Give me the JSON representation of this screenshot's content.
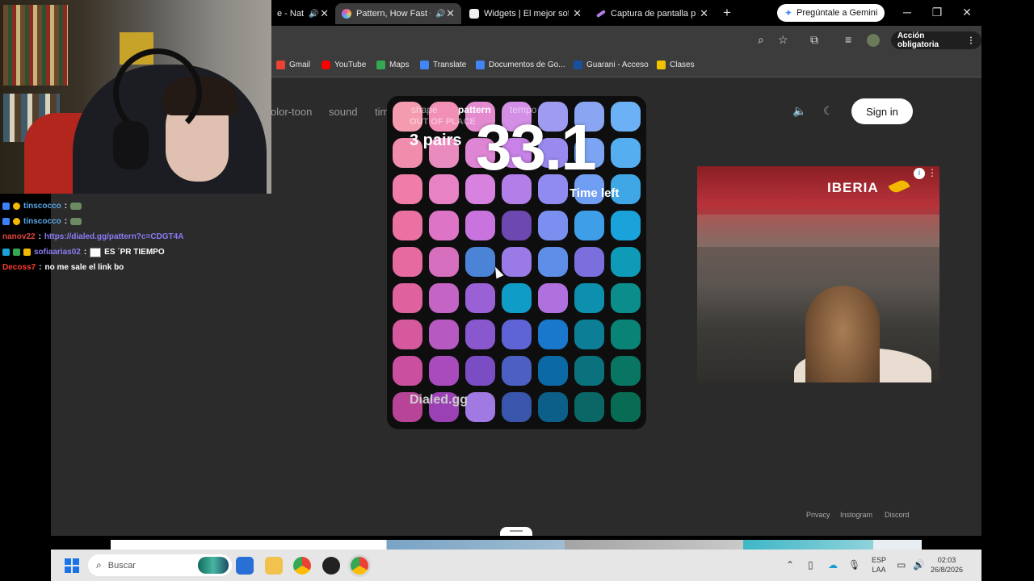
{
  "tabs": [
    {
      "label": "e - Nat",
      "audio": "🔊",
      "active": false,
      "color": "#e25555"
    },
    {
      "label": "Pattern, How Fast Ca",
      "audio": "🔊",
      "active": true,
      "color": "#b06cf0"
    },
    {
      "label": "Widgets | El mejor softw",
      "audio": "",
      "active": false,
      "color": "#f0f0f0"
    },
    {
      "label": "Captura de pantalla por",
      "audio": "",
      "active": false,
      "color": "#b07be8"
    }
  ],
  "gemini": "Pregúntale a Gemini",
  "toolbar": {
    "accion": "Acción obligatoria"
  },
  "bookmarks": [
    {
      "label": "Gmail",
      "color": "#ea4335"
    },
    {
      "label": "YouTube",
      "color": "#ff0000"
    },
    {
      "label": "Maps",
      "color": "#34a853"
    },
    {
      "label": "Translate",
      "color": "#4285f4"
    },
    {
      "label": "Documentos de Go...",
      "color": "#4285f4"
    },
    {
      "label": "Guarani - Acceso",
      "color": "#1a4fa0"
    },
    {
      "label": "Clases",
      "color": "#f2c200"
    }
  ],
  "site": {
    "nav": [
      "olor-toon",
      "sound",
      "time"
    ],
    "signin": "Sign in"
  },
  "game": {
    "tabs": [
      "shape",
      "pattern",
      "tempo"
    ],
    "subtitle": "OUT OF PLACE",
    "pairs": "3 pairs",
    "timer": "33.1",
    "time_left": "Time left",
    "brand": "Dialed.gg",
    "grid": [
      [
        "#f59bb0",
        "#f28fb5",
        "#e48bd0",
        "#d38ee5",
        "#9e9bf0",
        "#8aa6f2",
        "#6cb0f5"
      ],
      [
        "#f08cac",
        "#ea8bbf",
        "#de86d4",
        "#c882e8",
        "#9a8af0",
        "#7ba5f2",
        "#54aef0"
      ],
      [
        "#ef7da7",
        "#e782c4",
        "#d682de",
        "#b27ee8",
        "#8f8bf0",
        "#6f9ef2",
        "#3fa7e6"
      ],
      [
        "#ec71a3",
        "#de74c6",
        "#c974de",
        "#6c48b0",
        "#7b8ff0",
        "#3e9fe8",
        "#19a3da"
      ],
      [
        "#e6699f",
        "#d66fbd",
        "#4b84d6",
        "#9a7ae6",
        "#5f8ee8",
        "#7b6fde",
        "#0e9bb8"
      ],
      [
        "#df619e",
        "#c464c4",
        "#9a61d6",
        "#0f9dc8",
        "#b070de",
        "#0d8fae",
        "#0b8d8c"
      ],
      [
        "#d6599d",
        "#b65ac2",
        "#8957ce",
        "#5e63d6",
        "#1a78cc",
        "#0c7f97",
        "#0a8377"
      ],
      [
        "#ca4f9e",
        "#a94bbd",
        "#7a4dc4",
        "#4c5fc2",
        "#0b6aa6",
        "#0a727c",
        "#087662"
      ],
      [
        "#b84497",
        "#9a42b4",
        "#a07ae2",
        "#3a55ac",
        "#0b5f88",
        "#0b6766",
        "#086b54"
      ]
    ]
  },
  "ad": {
    "brand": "IBERIA"
  },
  "footer": [
    "Privacy",
    "Instogram",
    "Discord"
  ],
  "taskbar": {
    "search": "Buscar",
    "lang": [
      "ESP",
      "LAA"
    ],
    "time": "02:03",
    "date": "26/8/2026"
  },
  "chat": [
    {
      "user": "tinscocco",
      "user_color": "#5aa7e6",
      "sep": ":",
      "kind": "emote",
      "text": ""
    },
    {
      "user": "tinscocco",
      "user_color": "#5aa7e6",
      "sep": ":",
      "kind": "emote",
      "text": ""
    },
    {
      "user": "nanov22",
      "user_color": "#e0453a",
      "sep": ":",
      "kind": "link",
      "text": "https://dialed.gg/pattern?c=CDGT4A"
    },
    {
      "user": "sofiaarias02",
      "user_color": "#8a7df2",
      "sep": ":",
      "kind": "emote2",
      "text": "ES ´PR TIEMPO"
    },
    {
      "user": "Decoss7",
      "user_color": "#ff3b30",
      "sep": ":",
      "kind": "text",
      "text": "no me sale el link bo"
    }
  ]
}
